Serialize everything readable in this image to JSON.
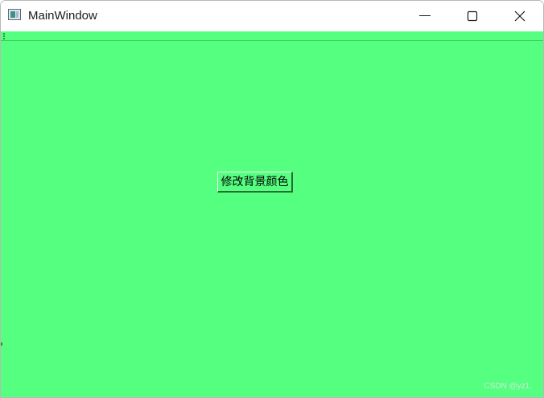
{
  "window": {
    "title": "MainWindow",
    "background_color": "#55ff7f"
  },
  "titlebar": {
    "app_icon": "window-app-icon",
    "minimize_icon": "minimize-icon",
    "maximize_icon": "maximize-icon",
    "close_icon": "close-icon"
  },
  "toolbar": {
    "grip_icon": "toolbar-grip-icon"
  },
  "central": {
    "button_label": "修改背景颜色"
  },
  "watermark": {
    "text": "CSDN @yz1."
  }
}
